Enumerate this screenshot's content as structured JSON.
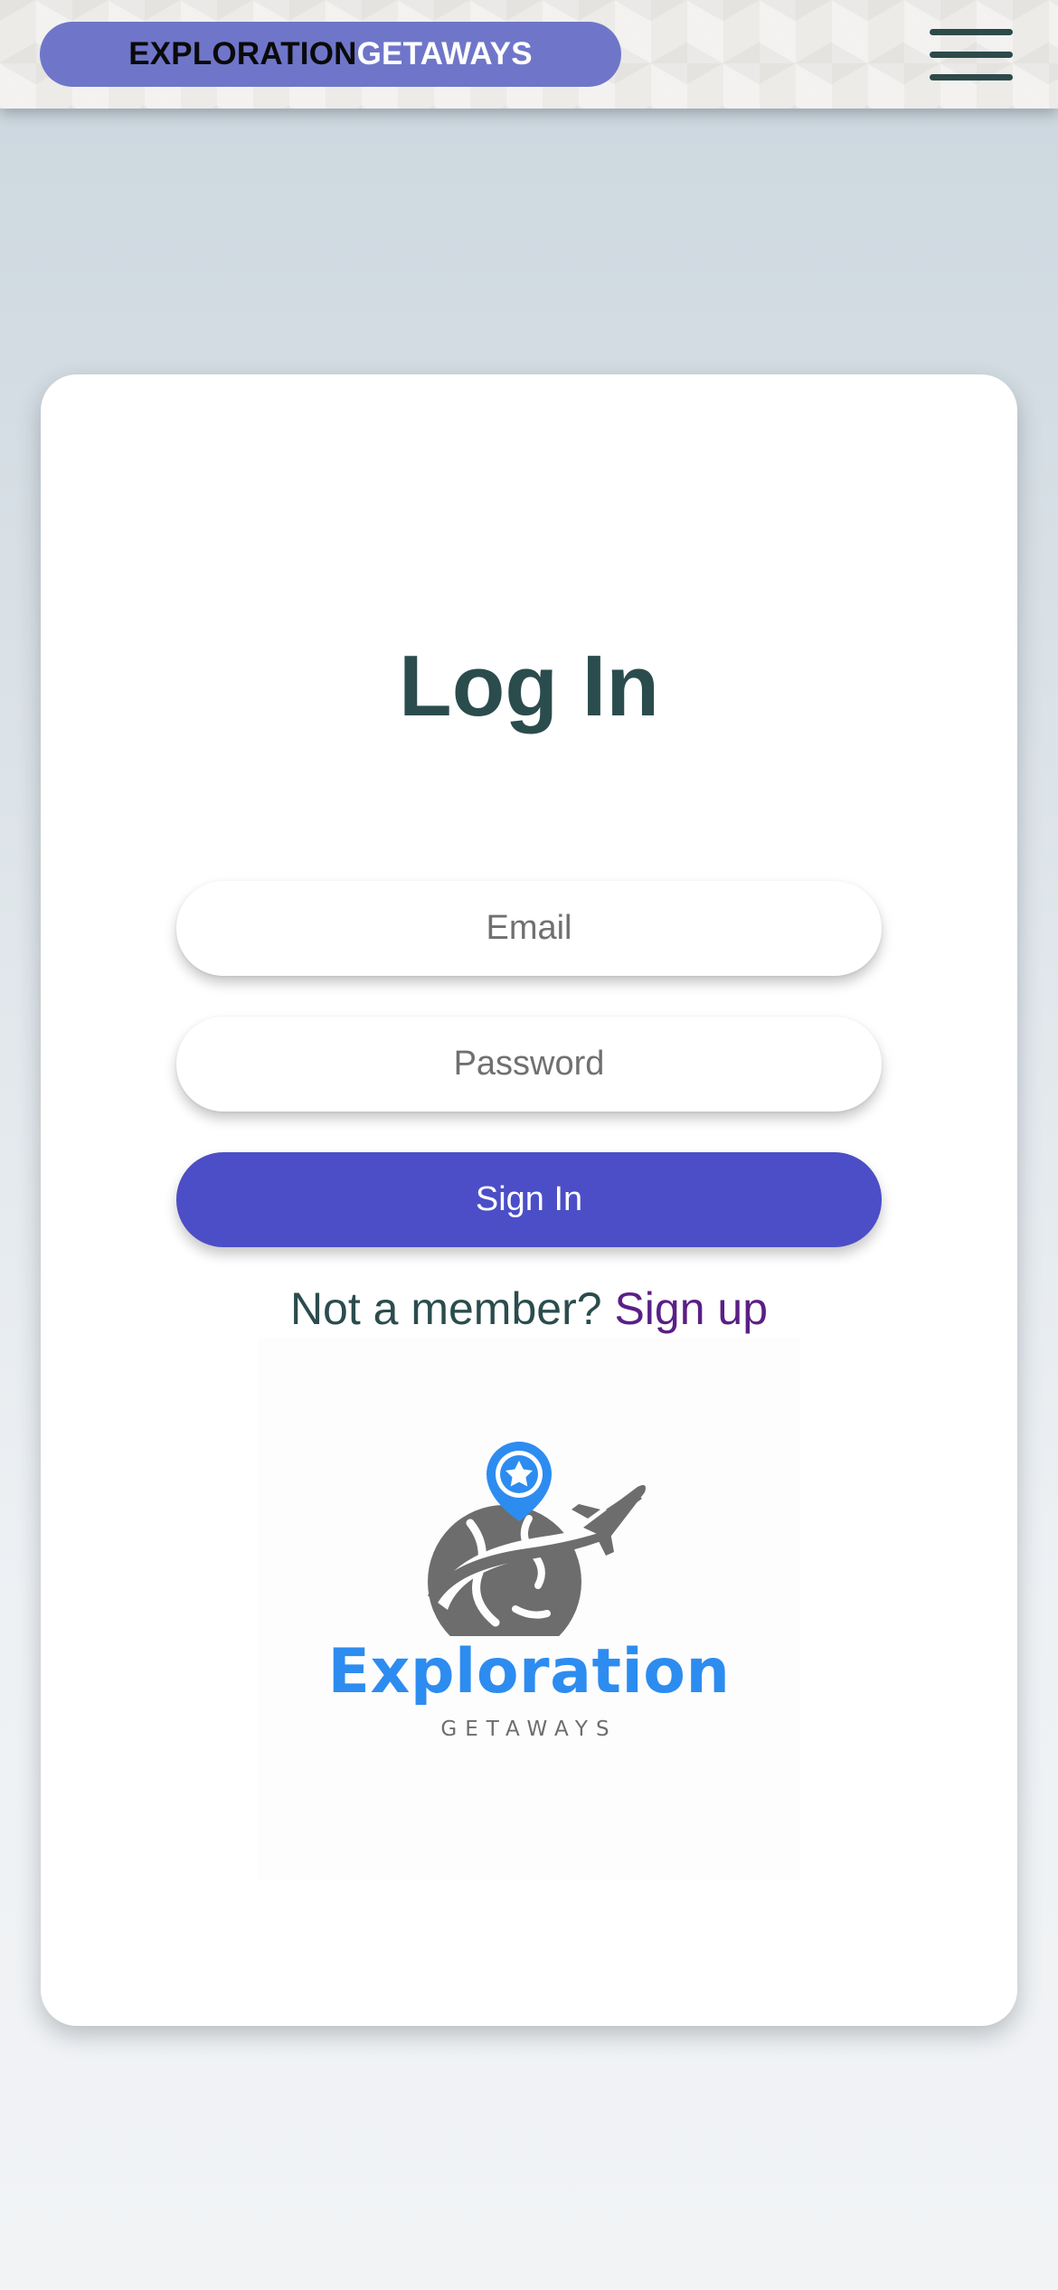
{
  "header": {
    "brand_part1": "EXPLORATION",
    "brand_part2": "GETAWAYS",
    "menu_icon": "hamburger-menu-icon",
    "colors": {
      "brand_pill": "#6f76c9",
      "menu_icon": "#2d4a4a"
    }
  },
  "login": {
    "title": "Log In",
    "email_placeholder": "Email",
    "password_placeholder": "Password",
    "signin_label": "Sign In",
    "member_prompt": "Not a member?",
    "signup_label": "Sign up",
    "colors": {
      "title": "#2b4c4d",
      "signin_button": "#4b4ec6",
      "signup_link": "#5a1f86"
    }
  },
  "logo": {
    "wordmark": "Exploration",
    "subtitle": "GETAWAYS",
    "icons": [
      "location-pin-star-icon",
      "globe-icon",
      "airplane-icon"
    ],
    "colors": {
      "wordmark": "#2d8cf0",
      "globe": "#6d6d6d"
    }
  }
}
